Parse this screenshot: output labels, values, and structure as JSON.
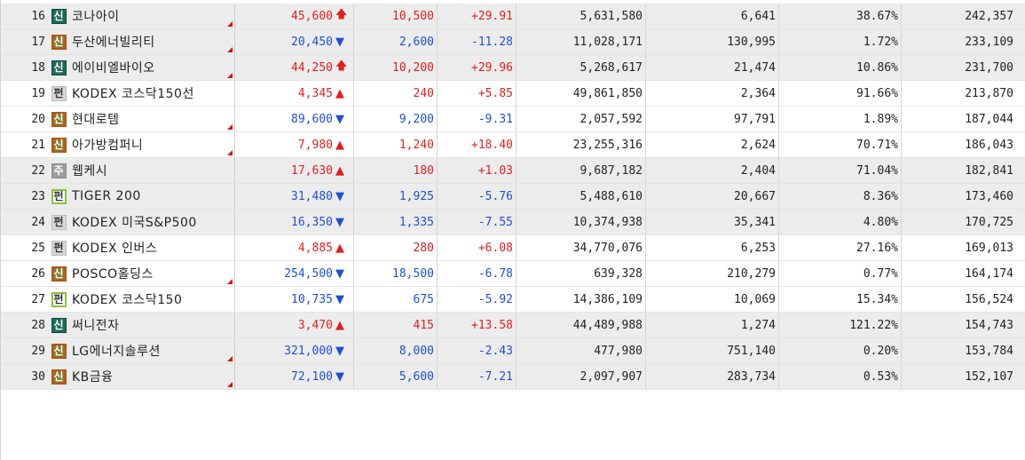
{
  "badge_colors": {
    "sin_dark": "#1f6b5a",
    "sin_brown": "#8a7a2a",
    "pyeon_gray": "#d8d8d8",
    "pyeon_green": "#8ac23a",
    "ju_gray": "#9c9c9c"
  },
  "colors": {
    "up": "#e02020",
    "down": "#2050d0"
  },
  "arrows": {
    "limit_up": "🡅",
    "up": "▲",
    "down": "▼"
  },
  "rows": [
    {
      "rank": "16",
      "badge": "신",
      "badge_style": "sin-dark",
      "name": "코나아이",
      "name_flag": true,
      "price": "45,600",
      "direction": "up",
      "arrow": "limit_up",
      "change": "10,500",
      "rate": "+29.91",
      "volume": "5,631,580",
      "value": "6,641",
      "turnover": "38.67%",
      "amount": "242,357",
      "group": 1
    },
    {
      "rank": "17",
      "badge": "신",
      "badge_style": "sin-brown",
      "name": "두산에너빌리티",
      "name_flag": true,
      "price": "20,450",
      "direction": "down",
      "arrow": "down",
      "change": "2,600",
      "rate": "-11.28",
      "volume": "11,028,171",
      "value": "130,995",
      "turnover": "1.72%",
      "amount": "233,109",
      "group": 1
    },
    {
      "rank": "18",
      "badge": "신",
      "badge_style": "sin-dark",
      "name": "에이비엘바이오",
      "name_flag": true,
      "price": "44,250",
      "direction": "up",
      "arrow": "limit_up",
      "change": "10,200",
      "rate": "+29.96",
      "volume": "5,268,617",
      "value": "21,474",
      "turnover": "10.86%",
      "amount": "231,700",
      "group": 1
    },
    {
      "rank": "19",
      "badge": "펀",
      "badge_style": "pyeon-gray",
      "name": "KODEX 코스닥150선",
      "name_flag": false,
      "price": "4,345",
      "direction": "up",
      "arrow": "up",
      "change": "240",
      "rate": "+5.85",
      "volume": "49,861,850",
      "value": "2,364",
      "turnover": "91.66%",
      "amount": "213,870",
      "group": 0
    },
    {
      "rank": "20",
      "badge": "신",
      "badge_style": "sin-brown",
      "name": "현대로템",
      "name_flag": true,
      "price": "89,600",
      "direction": "down",
      "arrow": "down",
      "change": "9,200",
      "rate": "-9.31",
      "volume": "2,057,592",
      "value": "97,791",
      "turnover": "1.89%",
      "amount": "187,044",
      "group": 0
    },
    {
      "rank": "21",
      "badge": "신",
      "badge_style": "sin-brown",
      "name": "아가방컴퍼니",
      "name_flag": true,
      "price": "7,980",
      "direction": "up",
      "arrow": "up",
      "change": "1,240",
      "rate": "+18.40",
      "volume": "23,255,316",
      "value": "2,624",
      "turnover": "70.71%",
      "amount": "186,043",
      "group": 0
    },
    {
      "rank": "22",
      "badge": "주",
      "badge_style": "ju-gray",
      "name": "웹케시",
      "name_flag": false,
      "price": "17,630",
      "direction": "up",
      "arrow": "up",
      "change": "180",
      "rate": "+1.03",
      "volume": "9,687,182",
      "value": "2,404",
      "turnover": "71.04%",
      "amount": "182,841",
      "group": 1
    },
    {
      "rank": "23",
      "badge": "펀",
      "badge_style": "pyeon-green",
      "name": "TIGER 200",
      "name_flag": false,
      "price": "31,480",
      "direction": "down",
      "arrow": "down",
      "change": "1,925",
      "rate": "-5.76",
      "volume": "5,488,610",
      "value": "20,667",
      "turnover": "8.36%",
      "amount": "173,460",
      "group": 1
    },
    {
      "rank": "24",
      "badge": "펀",
      "badge_style": "pyeon-gray",
      "name": "KODEX 미국S&P500",
      "name_flag": false,
      "price": "16,350",
      "direction": "down",
      "arrow": "down",
      "change": "1,335",
      "rate": "-7.55",
      "volume": "10,374,938",
      "value": "35,341",
      "turnover": "4.80%",
      "amount": "170,725",
      "group": 1
    },
    {
      "rank": "25",
      "badge": "펀",
      "badge_style": "pyeon-gray",
      "name": "KODEX 인버스",
      "name_flag": false,
      "price": "4,885",
      "direction": "up",
      "arrow": "up",
      "change": "280",
      "rate": "+6.08",
      "volume": "34,770,076",
      "value": "6,253",
      "turnover": "27.16%",
      "amount": "169,013",
      "group": 0
    },
    {
      "rank": "26",
      "badge": "신",
      "badge_style": "sin-brown",
      "name": "POSCO홀딩스",
      "name_flag": true,
      "price": "254,500",
      "direction": "down",
      "arrow": "down",
      "change": "18,500",
      "rate": "-6.78",
      "volume": "639,328",
      "value": "210,279",
      "turnover": "0.77%",
      "amount": "164,174",
      "group": 0
    },
    {
      "rank": "27",
      "badge": "펀",
      "badge_style": "pyeon-green",
      "name": "KODEX 코스닥150",
      "name_flag": false,
      "price": "10,735",
      "direction": "down",
      "arrow": "down",
      "change": "675",
      "rate": "-5.92",
      "volume": "14,386,109",
      "value": "10,069",
      "turnover": "15.34%",
      "amount": "156,524",
      "group": 0
    },
    {
      "rank": "28",
      "badge": "신",
      "badge_style": "sin-dark",
      "name": "써니전자",
      "name_flag": false,
      "price": "3,470",
      "direction": "up",
      "arrow": "up",
      "change": "415",
      "rate": "+13.58",
      "volume": "44,489,988",
      "value": "1,274",
      "turnover": "121.22%",
      "amount": "154,743",
      "group": 1
    },
    {
      "rank": "29",
      "badge": "신",
      "badge_style": "sin-brown",
      "name": "LG에너지솔루션",
      "name_flag": true,
      "price": "321,000",
      "direction": "down",
      "arrow": "down",
      "change": "8,000",
      "rate": "-2.43",
      "volume": "477,980",
      "value": "751,140",
      "turnover": "0.20%",
      "amount": "153,784",
      "group": 1
    },
    {
      "rank": "30",
      "badge": "신",
      "badge_style": "sin-brown",
      "name": "KB금융",
      "name_flag": true,
      "price": "72,100",
      "direction": "down",
      "arrow": "down",
      "change": "5,600",
      "rate": "-7.21",
      "volume": "2,097,907",
      "value": "283,734",
      "turnover": "0.53%",
      "amount": "152,107",
      "group": 1
    }
  ]
}
